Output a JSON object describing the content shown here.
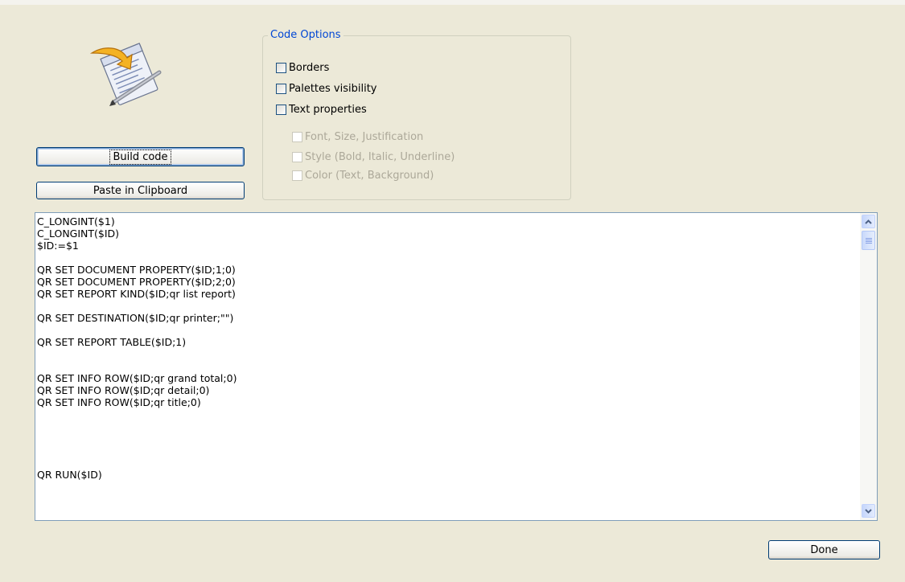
{
  "buttons": {
    "build_code": "Build code",
    "paste_clipboard": "Paste in Clipboard",
    "done": "Done"
  },
  "code_options": {
    "title": "Code Options",
    "borders": {
      "label": "Borders",
      "checked": false
    },
    "palettes_visibility": {
      "label": "Palettes visibility",
      "checked": false
    },
    "text_properties": {
      "label": "Text properties",
      "checked": false
    },
    "font_size_justification": {
      "label": "Font, Size, Justification",
      "checked": false,
      "enabled": false
    },
    "style": {
      "label": "Style (Bold, Italic, Underline)",
      "checked": false,
      "enabled": false
    },
    "color": {
      "label": "Color (Text, Background)",
      "checked": false,
      "enabled": false
    }
  },
  "code_lines": [
    "C_LONGINT($1)",
    "C_LONGINT($ID)",
    "$ID:=$1",
    "",
    "QR SET DOCUMENT PROPERTY($ID;1;0)",
    "QR SET DOCUMENT PROPERTY($ID;2;0)",
    "QR SET REPORT KIND($ID;qr list report)",
    "",
    "QR SET DESTINATION($ID;qr printer;\"\")",
    "",
    "QR SET REPORT TABLE($ID;1)",
    "",
    "",
    "QR SET INFO ROW($ID;qr grand total;0)",
    "QR SET INFO ROW($ID;qr detail;0)",
    "QR SET INFO ROW($ID;qr title;0)",
    "",
    "",
    "",
    "",
    "",
    "QR RUN($ID)"
  ],
  "icons": {
    "app_icon": "document-with-pencil-icon",
    "scroll_up": "scroll-up-arrow-icon",
    "scroll_down": "scroll-down-arrow-icon"
  },
  "colors": {
    "background": "#ece9d8",
    "group_title": "#0046d5",
    "button_border": "#003c74",
    "disabled_text": "#aca899"
  }
}
